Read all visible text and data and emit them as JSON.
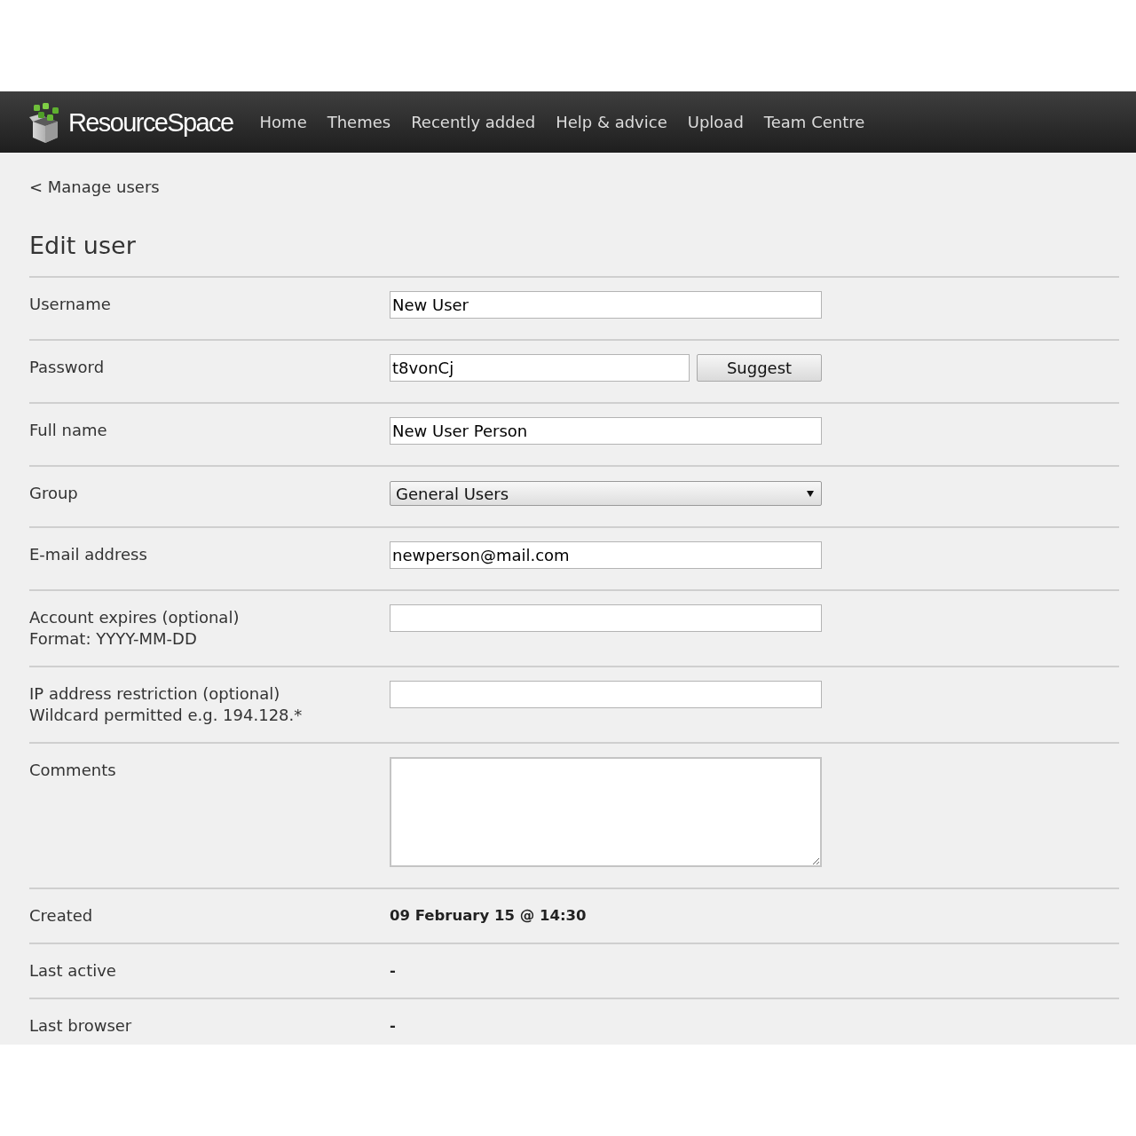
{
  "header": {
    "logo": "ResourceSpace",
    "nav": [
      {
        "label": "Home"
      },
      {
        "label": "Themes"
      },
      {
        "label": "Recently added"
      },
      {
        "label": "Help & advice"
      },
      {
        "label": "Upload"
      },
      {
        "label": "Team Centre"
      }
    ]
  },
  "back_link": "< Manage users",
  "title": "Edit user",
  "form": {
    "rows": [
      {
        "kind": "text",
        "label": "Username",
        "value": "New User"
      },
      {
        "kind": "password",
        "label": "Password",
        "value": "t8vonCj",
        "button": "Suggest"
      },
      {
        "kind": "text",
        "label": "Full name",
        "value": "New User Person"
      },
      {
        "kind": "select",
        "label": "Group",
        "value": "General Users"
      },
      {
        "kind": "text",
        "label": "E-mail address",
        "value": "newperson@mail.com"
      },
      {
        "kind": "text",
        "label": "Account expires (optional)",
        "hint": "Format: YYYY-MM-DD"
      },
      {
        "kind": "text",
        "label": "IP address restriction (optional)",
        "hint": "Wildcard permitted e.g. 194.128.*"
      },
      {
        "kind": "textarea",
        "label": "Comments"
      },
      {
        "kind": "static",
        "label": "Created",
        "value": "09 February 15 @ 14:30"
      },
      {
        "kind": "static",
        "label": "Last active",
        "value": "-"
      },
      {
        "kind": "static",
        "label": "Last browser",
        "value": "-"
      }
    ]
  }
}
